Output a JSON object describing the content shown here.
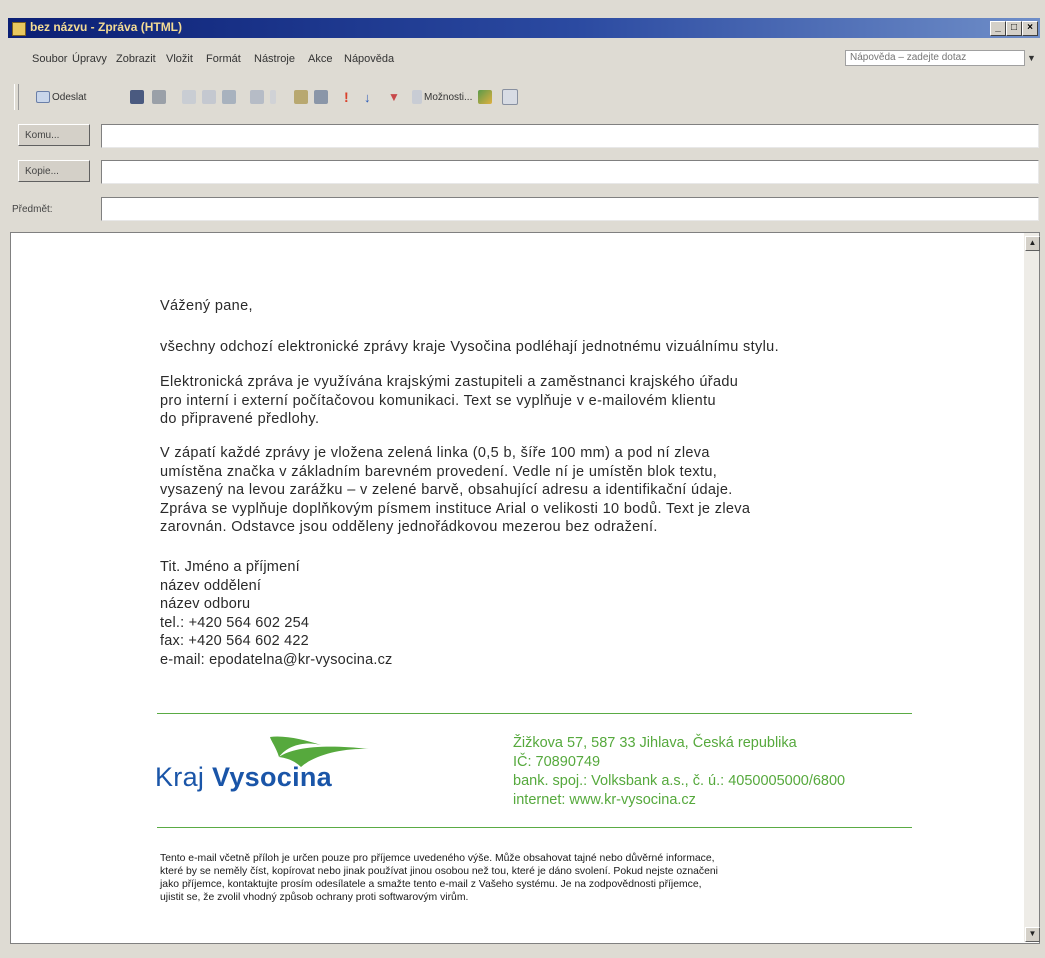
{
  "window": {
    "title": "bez názvu - Zpráva (HTML)",
    "controls": {
      "minimize": "_",
      "maximize": "□",
      "close": "×"
    }
  },
  "menu": {
    "items": [
      "Soubor",
      "Úpravy",
      "Zobrazit",
      "Vložit",
      "Formát",
      "Nástroje",
      "Akce",
      "Nápověda"
    ],
    "help_placeholder": "Nápověda – zadejte dotaz"
  },
  "toolbar": {
    "send_label": "Odeslat",
    "options_label": "Možnosti..."
  },
  "fields": {
    "to_label": "Komu...",
    "cc_label": "Kopie...",
    "subject_label": "Předmět:",
    "to_value": "",
    "cc_value": "",
    "subject_value": ""
  },
  "message": {
    "greeting": "Vážený pane,",
    "paragraph1": "všechny odchozí elektronické zprávy kraje Vysočina podléhají jednotnému vizuálnímu stylu.",
    "paragraph2_lines": [
      "Elektronická zpráva je využívána krajskými zastupiteli a zaměstnanci krajského úřadu",
      "pro interní i externí počítačovou komunikaci. Text se vyplňuje v e-mailovém klientu",
      "do připravené předlohy."
    ],
    "paragraph3_lines": [
      "V zápatí každé zprávy je vložena zelená linka (0,5 b, šíře 100 mm) a pod ní zleva",
      "umístěna značka v základním barevném provedení. Vedle ní je umístěn blok textu,",
      "vysazený na levou zarážku – v zelené barvě, obsahující adresu a identifikační údaje.",
      "Zpráva se vyplňuje doplňkovým písmem instituce Arial o velikosti 10 bodů. Text je zleva",
      "zarovnán. Odstavce jsou odděleny jednořádkovou mezerou bez odražení."
    ],
    "signature": [
      "Tit. Jméno a příjmení",
      "název oddělení",
      "název odboru",
      "tel.: +420 564 602 254",
      "fax: +420  564 602 422",
      "e-mail: epodatelna@kr-vysocina.cz"
    ]
  },
  "footer": {
    "logo_text_light": "Kraj",
    "logo_text_bold": "Vysocina",
    "address_lines": [
      "Žižkova 57, 587 33 Jihlava, Česká republika",
      "IČ: 70890749",
      "bank. spoj.: Volksbank a.s., č. ú.: 4050005000/6800",
      "internet: www.kr-vysocina.cz"
    ],
    "disclaimer_lines": [
      "Tento e-mail včetně příloh je určen pouze pro příjemce uvedeného výše. Může obsahovat tajné nebo důvěrné informace,",
      "které by se neměly číst, kopírovat nebo jinak používat jinou osobou než tou, které je dáno svolení. Pokud nejste označeni",
      "jako příjemce, kontaktujte prosím odesílatele a smažte tento e-mail z Vašeho systému. Je na zodpovědnosti příjemce,",
      "ujistit se, že zvolil vhodný způsob ochrany proti softwarovým virům."
    ]
  },
  "colors": {
    "title_bar": "#0b1f74",
    "title_text": "#f4dc94",
    "brand_green": "#56a93d",
    "brand_blue": "#1a55a8"
  }
}
